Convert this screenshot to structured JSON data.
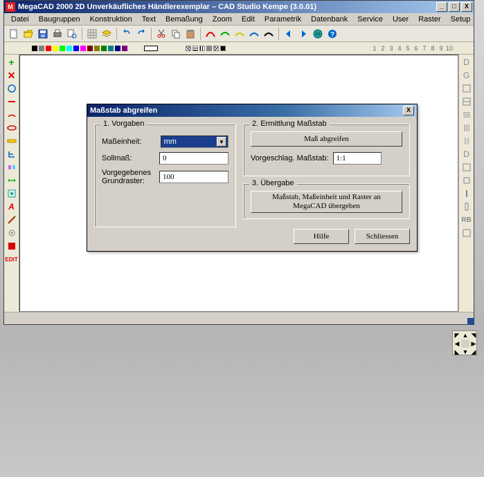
{
  "window": {
    "title": "MegaCAD 2000 2D  Unverkäufliches Händlerexemplar – CAD Studio Kempe  (3.0.01)",
    "min": "_",
    "max": "□",
    "close": "X"
  },
  "menu": [
    "Datei",
    "Baugruppen",
    "Konstruktion",
    "Text",
    "Bemaßung",
    "Zoom",
    "Edit",
    "Parametrik",
    "Datenbank",
    "Service",
    "User",
    "Raster",
    "Setup"
  ],
  "toolbar_icons": [
    "new",
    "open",
    "save",
    "print",
    "preview",
    "sep",
    "grid",
    "layer",
    "sep",
    "undo",
    "redo",
    "sep",
    "cut",
    "copy",
    "paste",
    "sep",
    "curve1",
    "curve2",
    "curve3",
    "curve4",
    "curve5",
    "sep",
    "arrow-l",
    "arrow-r",
    "globe",
    "help"
  ],
  "colors_strip": [
    "#000000",
    "#808080",
    "#ff0000",
    "#ffff00",
    "#00ff00",
    "#00ffff",
    "#0000ff",
    "#ff00ff",
    "#800000",
    "#808000",
    "#008000",
    "#008080",
    "#000080",
    "#800080"
  ],
  "hatch_labels": [
    "",
    "",
    ""
  ],
  "number_strip": [
    "1",
    "2",
    "3",
    "4",
    "5",
    "6",
    "7",
    "8",
    "9",
    "10"
  ],
  "left_tools": [
    "plus",
    "x-red",
    "circle-blue",
    "minus",
    "half",
    "omega-red",
    "rule",
    "clamp",
    "eq",
    "dim",
    "link",
    "text-a",
    "diag",
    "gear",
    "red-sq",
    "EDIT"
  ],
  "right_tools": [
    "D",
    "G",
    "sq",
    "sq2",
    "bars",
    "vbars",
    "vbars2",
    "D2",
    "sq3",
    "sq4",
    "I1",
    "I2",
    "RB",
    "sq5"
  ],
  "dialog": {
    "title": "Maßstab abgreifen",
    "close": "X",
    "group1": {
      "legend": "1. Vorgaben",
      "unit_label": "Maßeinheit:",
      "unit_value": "mm",
      "sollmass_label": "Sollmaß:",
      "sollmass_value": "0",
      "raster_label": "Vorgegebenes Grundraster:",
      "raster_value": "100"
    },
    "group2": {
      "legend": "2. Ermittlung Maßstab",
      "btn_pick": "Maß abgreifen",
      "suggest_label": "Vorgeschlag. Maßstab:",
      "suggest_value": "1:1"
    },
    "group3": {
      "legend": "3. Übergabe",
      "btn_transfer": "Maßstab, Maßeinheit und Raster an MegaCAD übergeben"
    },
    "btn_help": "Hilfe",
    "btn_close": "Schliessen"
  }
}
